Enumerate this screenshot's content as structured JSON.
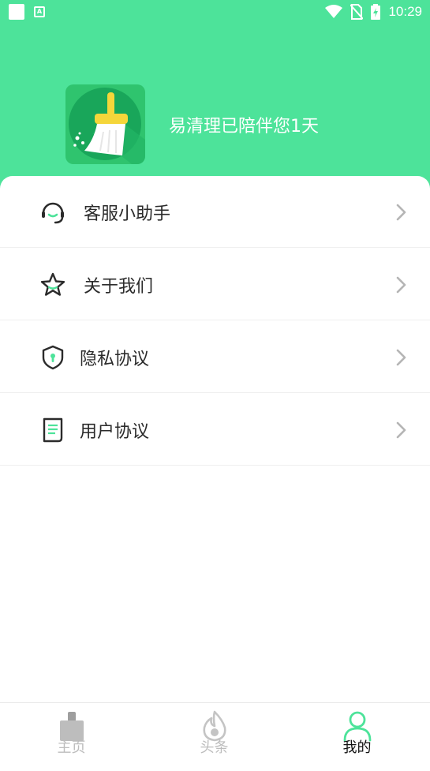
{
  "status_bar": {
    "time": "10:29",
    "icons": [
      "app-square-icon",
      "a-icon",
      "wifi-icon",
      "no-sim-icon",
      "battery-charging-icon"
    ]
  },
  "header": {
    "motto": "易清理已陪伴您1天",
    "logo_icon": "broom-icon"
  },
  "menu": {
    "items": [
      {
        "label": "客服小助手",
        "icon": "headset-icon"
      },
      {
        "label": "关于我们",
        "icon": "star-icon"
      },
      {
        "label": "隐私协议",
        "icon": "shield-icon"
      },
      {
        "label": "用户协议",
        "icon": "document-icon"
      }
    ]
  },
  "tabbar": {
    "tabs": [
      {
        "label": "主页",
        "icon": "home-broom-icon",
        "active": false
      },
      {
        "label": "头条",
        "icon": "flame-icon",
        "active": false
      },
      {
        "label": "我的",
        "icon": "person-icon",
        "active": true
      }
    ]
  },
  "colors": {
    "brand_green": "#4de39a",
    "logo_green": "#2fc46e",
    "broom_yellow": "#f5d63a",
    "active_icon": "#4de39a",
    "inactive_tab": "#bdbdbd"
  }
}
